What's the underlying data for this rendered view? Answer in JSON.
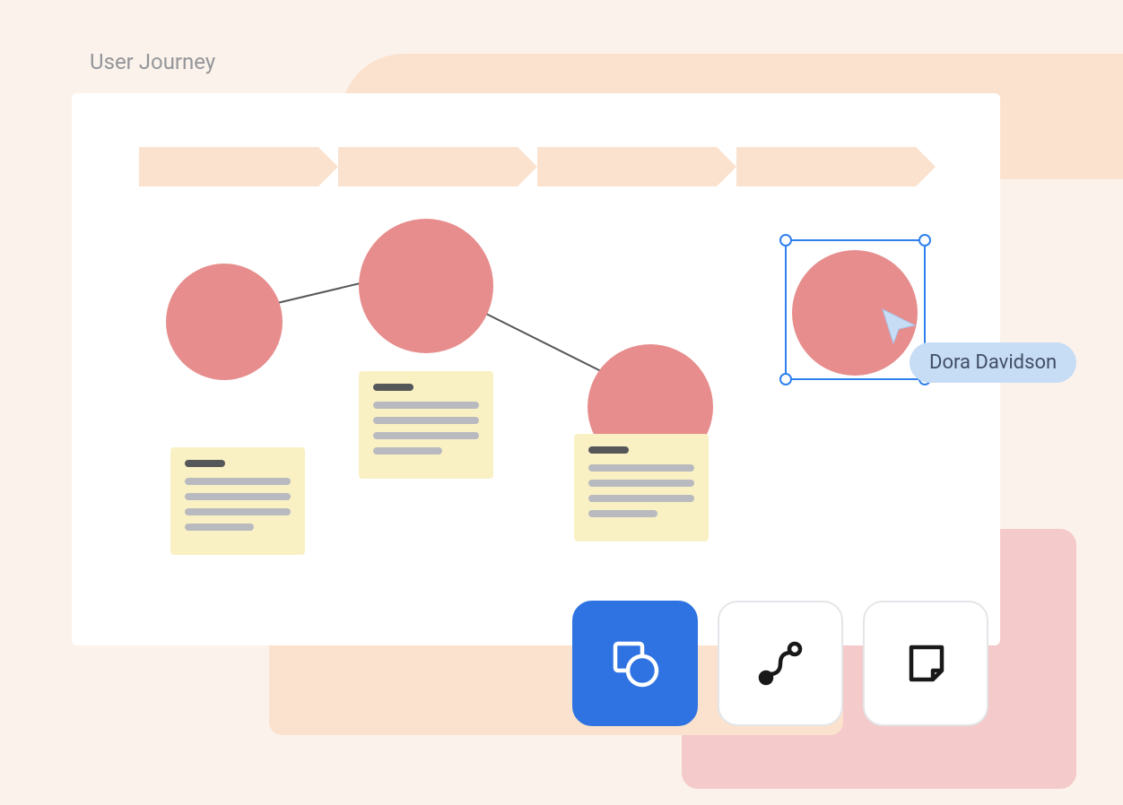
{
  "title": "User Journey",
  "collaborator": {
    "name": "Dora Davidson"
  },
  "toolbar": {
    "shapes": {
      "name": "shapes-tool",
      "active": true
    },
    "connector": {
      "name": "connector-tool",
      "active": false
    },
    "sticky": {
      "name": "sticky-note-tool",
      "active": false
    }
  },
  "stages": {
    "count": 4
  },
  "nodes": [
    {
      "id": "circle-1"
    },
    {
      "id": "circle-2"
    },
    {
      "id": "circle-3"
    },
    {
      "id": "circle-4-selected"
    }
  ],
  "colors": {
    "accent": "#2F73E2",
    "selection": "#2F80ED",
    "node": "#E78D8D",
    "note": "#F9F1C4",
    "stage": "#FBE2CE",
    "background": "#FBF2EB"
  }
}
